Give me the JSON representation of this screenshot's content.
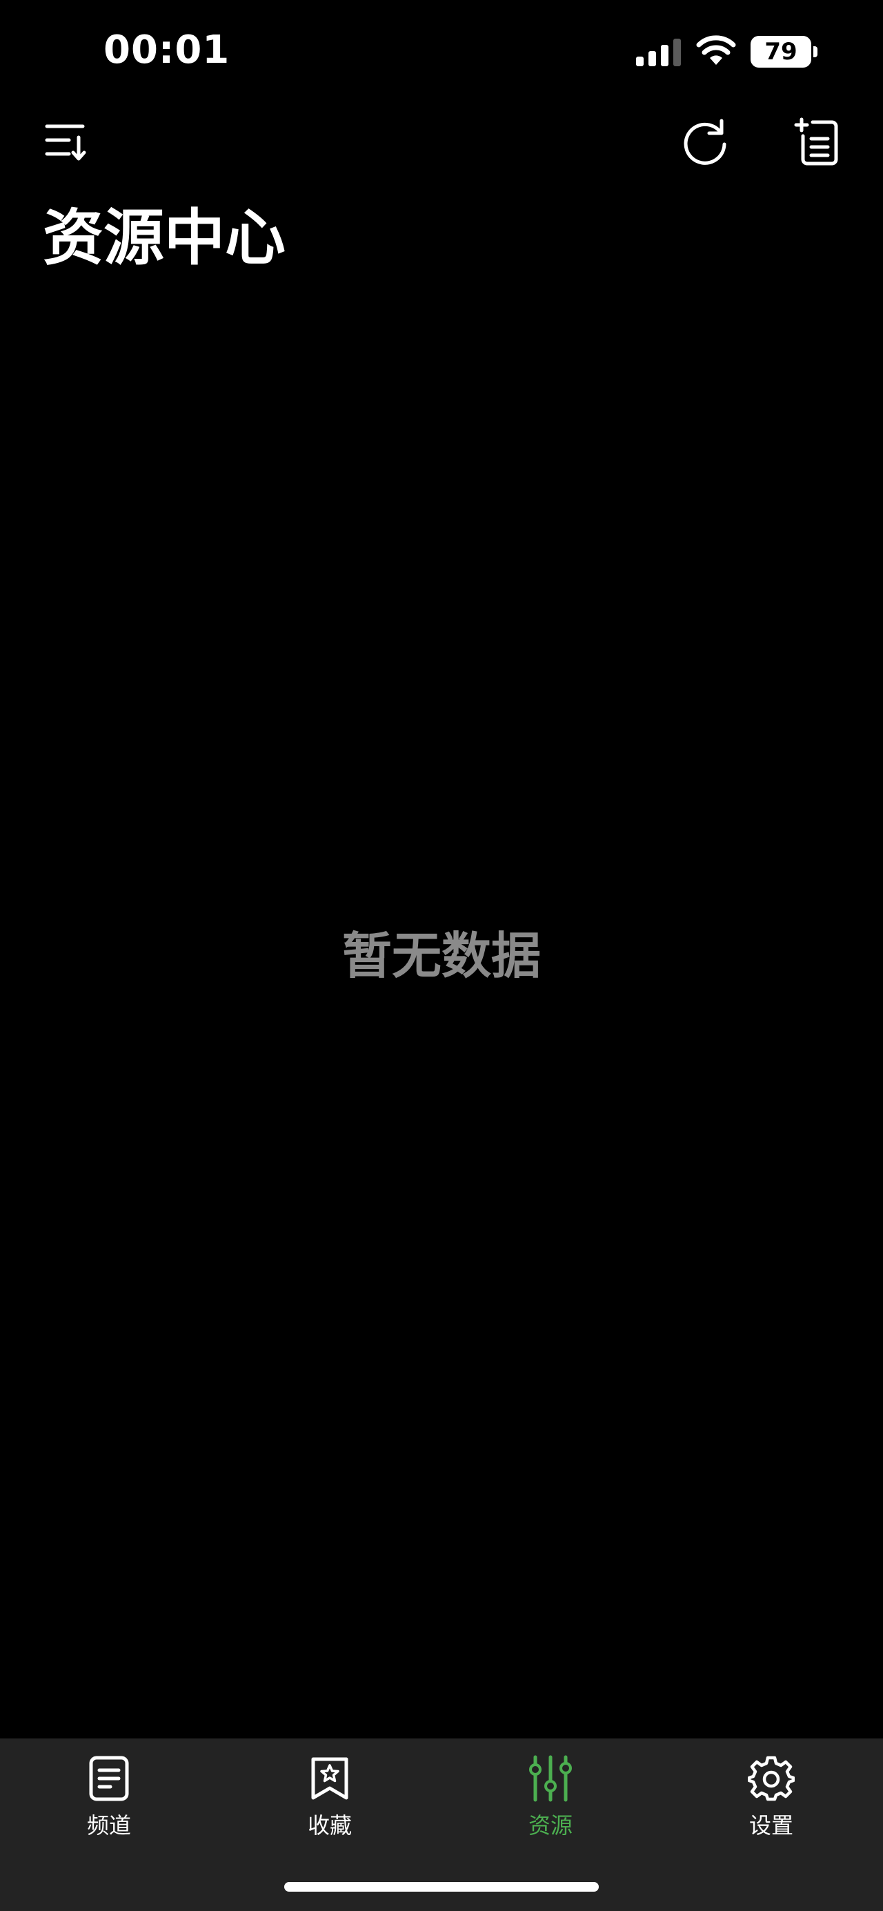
{
  "status_bar": {
    "time": "00:01",
    "battery_level": "79"
  },
  "header": {
    "title": "资源中心",
    "icons": [
      "sort-icon",
      "refresh-icon",
      "add-list-icon"
    ]
  },
  "main": {
    "empty_text": "暂无数据"
  },
  "tab_bar": {
    "tabs": [
      {
        "label": "频道",
        "icon": "document-icon",
        "active": false
      },
      {
        "label": "收藏",
        "icon": "bookmark-star-icon",
        "active": false
      },
      {
        "label": "资源",
        "icon": "sliders-icon",
        "active": true
      },
      {
        "label": "设置",
        "icon": "gear-icon",
        "active": false
      }
    ]
  },
  "colors": {
    "background": "#000000",
    "tab_bar_background": "#232323",
    "accent": "#4caf50",
    "empty_text": "#8a8a8a"
  }
}
